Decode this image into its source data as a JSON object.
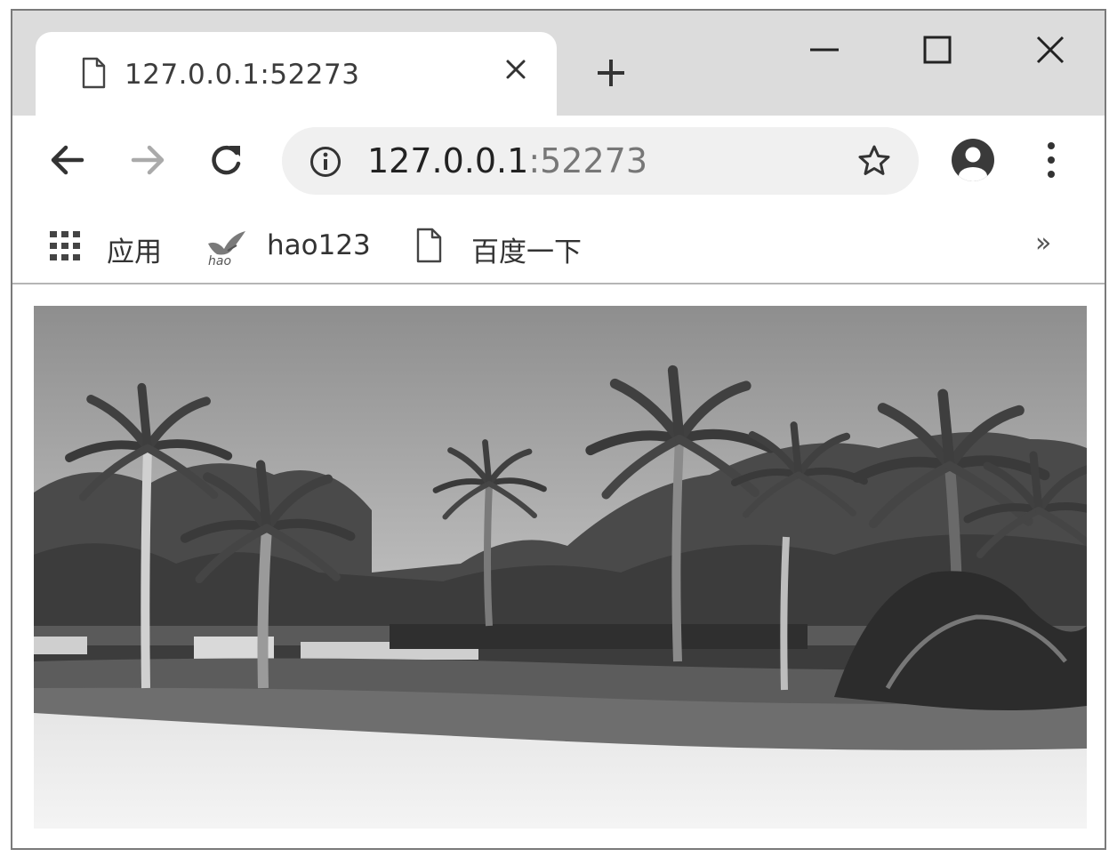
{
  "tab": {
    "title": "127.0.0.1:52273",
    "icon": "page-icon",
    "close_icon": "close-icon"
  },
  "new_tab_icon": "plus-icon",
  "window_controls": [
    "minimize-icon",
    "maximize-icon",
    "close-icon"
  ],
  "toolbar": {
    "back_icon": "arrow-left-icon",
    "forward_icon": "arrow-right-icon",
    "reload_icon": "reload-icon",
    "address": {
      "host": "127.0.0.1",
      "port": ":52273",
      "info_icon": "info-icon"
    },
    "bookmark_star_icon": "star-icon",
    "profile_icon": "account-icon",
    "menu_icon": "kebab-menu-icon"
  },
  "bookmarks": {
    "items": [
      {
        "label": "应用",
        "icon": "apps-grid-icon"
      },
      {
        "label": "hao123",
        "icon": "hao123-logo"
      },
      {
        "label": "百度一下",
        "icon": "page-icon"
      }
    ],
    "overflow": "»"
  },
  "content": {
    "image": "photo-palm-trees-beach"
  },
  "colors": {
    "titlebar": "#dcdcdc",
    "omnibox": "#f0f0f0",
    "window_border": "#7a7a7a"
  }
}
